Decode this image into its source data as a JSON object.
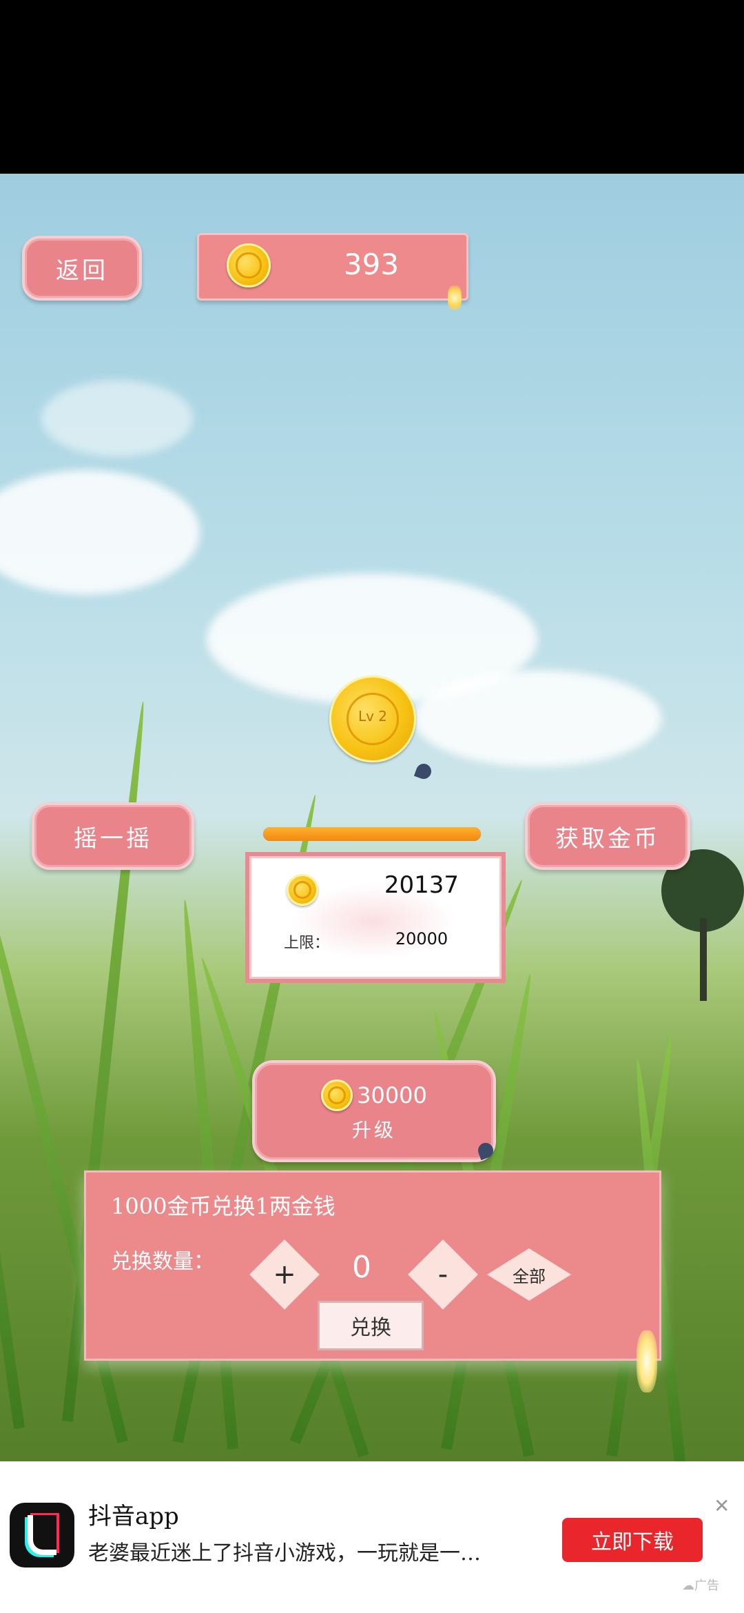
{
  "header": {
    "back_label": "返回",
    "coin_balance": "393"
  },
  "level": {
    "label": "Lv 2",
    "progress": 1.0
  },
  "actions": {
    "shake_label": "摇一摇",
    "get_coins_label": "获取金币"
  },
  "storage": {
    "coins": "20137",
    "limit_label": "上限：",
    "limit_value": "20000"
  },
  "upgrade": {
    "cost": "30000",
    "label": "升级"
  },
  "exchange": {
    "rate_text": "1000金币兑换1两金钱",
    "qty_label": "兑换数量：",
    "plus": "+",
    "qty_value": "0",
    "minus": "-",
    "all_label": "全部",
    "submit_label": "兑换"
  },
  "ad": {
    "app_name": "抖音app",
    "description": "老婆最近迷上了抖音小游戏，一玩就是一…",
    "download_label": "立即下载",
    "close_glyph": "✕",
    "ad_tag": "广告",
    "brand_color": "#e8262c"
  }
}
